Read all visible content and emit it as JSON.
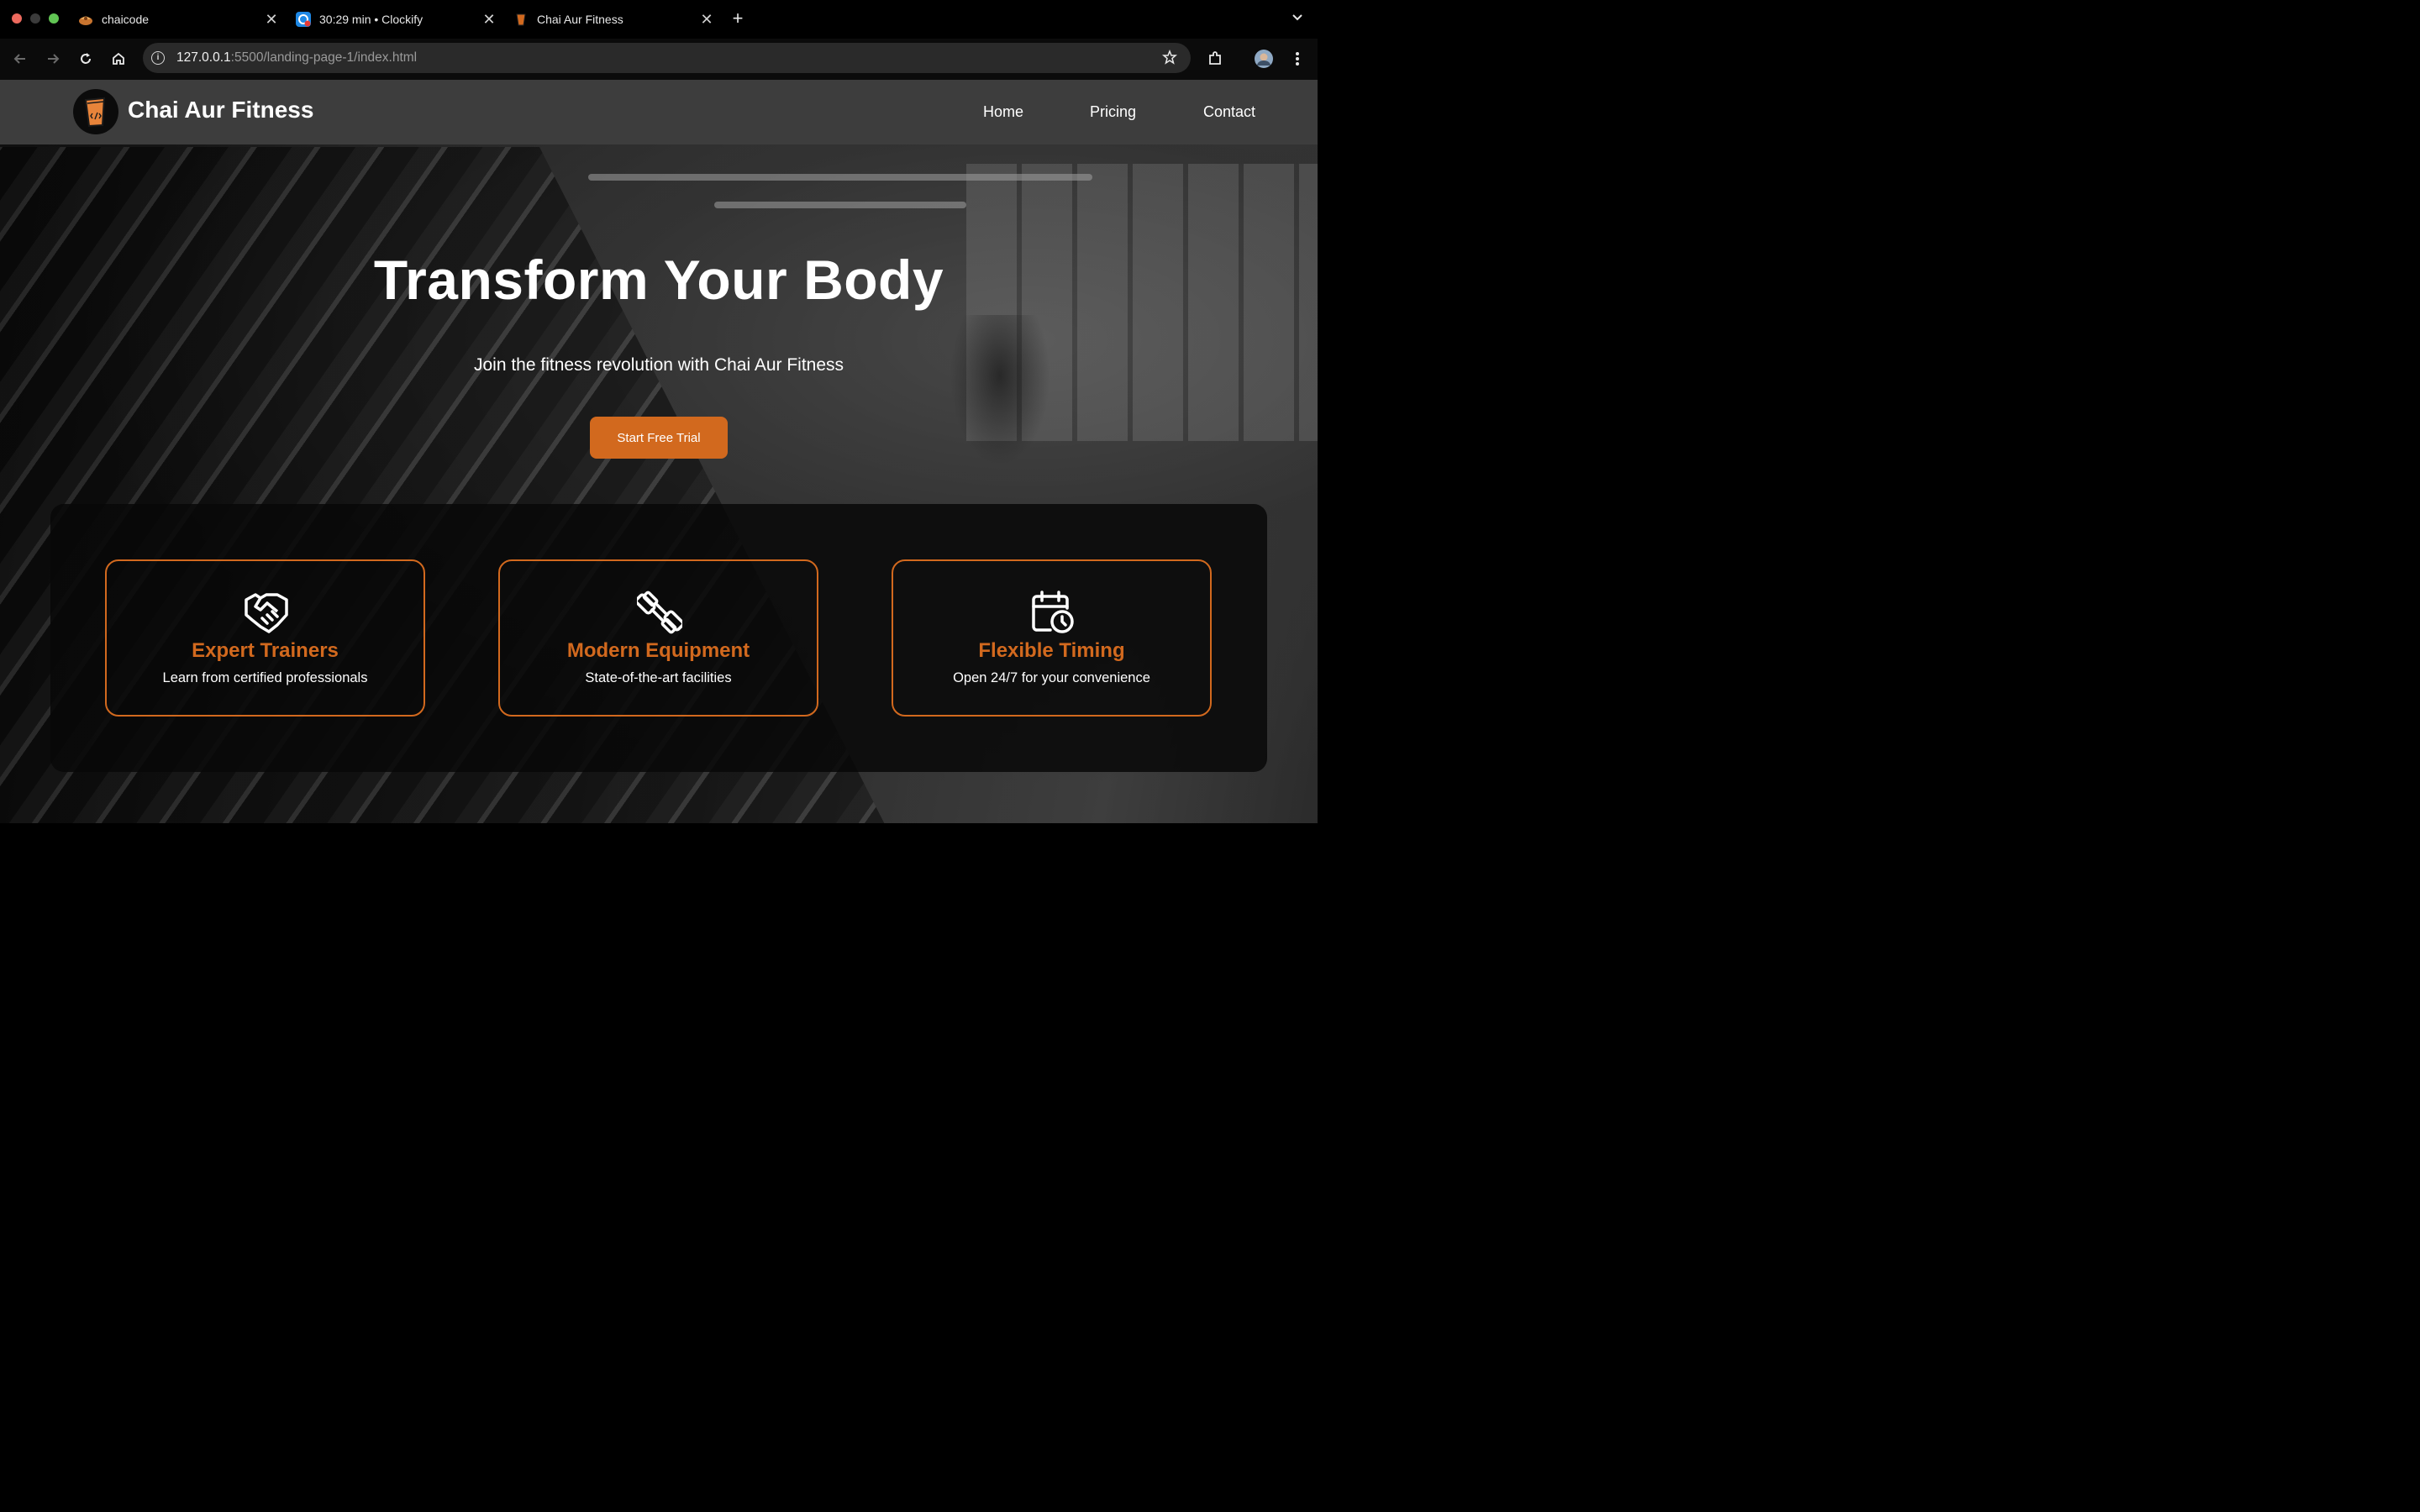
{
  "browser": {
    "tabs": [
      {
        "title": "chaicode",
        "favicon": "chaicode-favicon"
      },
      {
        "title": "30:29 min • Clockify",
        "favicon": "clockify-favicon"
      },
      {
        "title": "Chai Aur Fitness",
        "favicon": "chai-cup-favicon"
      }
    ],
    "close_glyph": "✕",
    "new_tab_glyph": "+",
    "url_host": "127.0.0.1",
    "url_rest": ":5500/landing-page-1/index.html"
  },
  "site": {
    "brand": "Chai Aur Fitness",
    "nav": [
      "Home",
      "Pricing",
      "Contact"
    ]
  },
  "hero": {
    "title": "Transform Your Body",
    "subtitle": "Join the fitness revolution with Chai Aur Fitness",
    "cta": "Start Free Trial"
  },
  "features": [
    {
      "icon": "handshake-icon",
      "title": "Expert Trainers",
      "desc": "Learn from certified professionals"
    },
    {
      "icon": "dumbbell-icon",
      "title": "Modern Equipment",
      "desc": "State-of-the-art facilities"
    },
    {
      "icon": "calendar-clock-icon",
      "title": "Flexible Timing",
      "desc": "Open 24/7 for your convenience"
    }
  ],
  "colors": {
    "accent": "#d2691e",
    "header_bg": "#3d3d3d",
    "browser_bg": "#000000"
  }
}
